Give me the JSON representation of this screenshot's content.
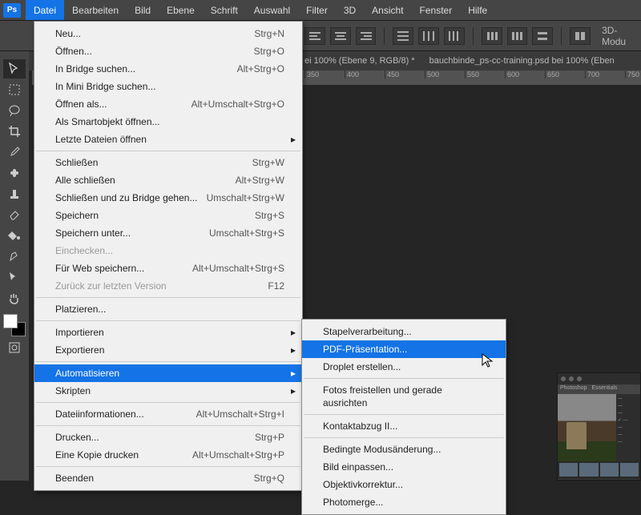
{
  "app_icon": "Ps",
  "menubar": [
    "Datei",
    "Bearbeiten",
    "Bild",
    "Ebene",
    "Schrift",
    "Auswahl",
    "Filter",
    "3D",
    "Ansicht",
    "Fenster",
    "Hilfe"
  ],
  "menubar_active": 0,
  "options_label": "3D-Modu",
  "tabs": [
    "ei 100% (Ebene 9, RGB/8) *",
    "bauchbinde_ps-cc-training.psd bei 100% (Eben"
  ],
  "ruler_ticks": [
    "350",
    "400",
    "450",
    "500",
    "550",
    "600",
    "650",
    "700",
    "750"
  ],
  "file_menu": [
    {
      "t": "item",
      "label": "Neu...",
      "sc": "Strg+N"
    },
    {
      "t": "item",
      "label": "Öffnen...",
      "sc": "Strg+O"
    },
    {
      "t": "item",
      "label": "In Bridge suchen...",
      "sc": "Alt+Strg+O"
    },
    {
      "t": "item",
      "label": "In Mini Bridge suchen..."
    },
    {
      "t": "item",
      "label": "Öffnen als...",
      "sc": "Alt+Umschalt+Strg+O"
    },
    {
      "t": "item",
      "label": "Als Smartobjekt öffnen..."
    },
    {
      "t": "item",
      "label": "Letzte Dateien öffnen",
      "sub": true
    },
    {
      "t": "sep"
    },
    {
      "t": "item",
      "label": "Schließen",
      "sc": "Strg+W"
    },
    {
      "t": "item",
      "label": "Alle schließen",
      "sc": "Alt+Strg+W"
    },
    {
      "t": "item",
      "label": "Schließen und zu Bridge gehen...",
      "sc": "Umschalt+Strg+W"
    },
    {
      "t": "item",
      "label": "Speichern",
      "sc": "Strg+S"
    },
    {
      "t": "item",
      "label": "Speichern unter...",
      "sc": "Umschalt+Strg+S"
    },
    {
      "t": "item",
      "label": "Einchecken...",
      "disabled": true
    },
    {
      "t": "item",
      "label": "Für Web speichern...",
      "sc": "Alt+Umschalt+Strg+S"
    },
    {
      "t": "item",
      "label": "Zurück zur letzten Version",
      "sc": "F12",
      "disabled": true
    },
    {
      "t": "sep"
    },
    {
      "t": "item",
      "label": "Platzieren..."
    },
    {
      "t": "sep"
    },
    {
      "t": "item",
      "label": "Importieren",
      "sub": true
    },
    {
      "t": "item",
      "label": "Exportieren",
      "sub": true
    },
    {
      "t": "sep"
    },
    {
      "t": "item",
      "label": "Automatisieren",
      "sub": true,
      "highlight": true
    },
    {
      "t": "item",
      "label": "Skripten",
      "sub": true
    },
    {
      "t": "sep"
    },
    {
      "t": "item",
      "label": "Dateiinformationen...",
      "sc": "Alt+Umschalt+Strg+I"
    },
    {
      "t": "sep"
    },
    {
      "t": "item",
      "label": "Drucken...",
      "sc": "Strg+P"
    },
    {
      "t": "item",
      "label": "Eine Kopie drucken",
      "sc": "Alt+Umschalt+Strg+P"
    },
    {
      "t": "sep"
    },
    {
      "t": "item",
      "label": "Beenden",
      "sc": "Strg+Q"
    }
  ],
  "submenu": [
    {
      "t": "item",
      "label": "Stapelverarbeitung..."
    },
    {
      "t": "item",
      "label": "PDF-Präsentation...",
      "highlight": true
    },
    {
      "t": "item",
      "label": "Droplet erstellen..."
    },
    {
      "t": "sep"
    },
    {
      "t": "item",
      "label": "Fotos freistellen und gerade ausrichten"
    },
    {
      "t": "sep"
    },
    {
      "t": "item",
      "label": "Kontaktabzug II..."
    },
    {
      "t": "sep"
    },
    {
      "t": "item",
      "label": "Bedingte Modusänderung..."
    },
    {
      "t": "item",
      "label": "Bild einpassen..."
    },
    {
      "t": "item",
      "label": "Objektivkorrektur..."
    },
    {
      "t": "item",
      "label": "Photomerge..."
    }
  ],
  "thumb_side": [
    "—",
    "—",
    "—",
    "✓ —",
    "—",
    "—",
    "—"
  ]
}
